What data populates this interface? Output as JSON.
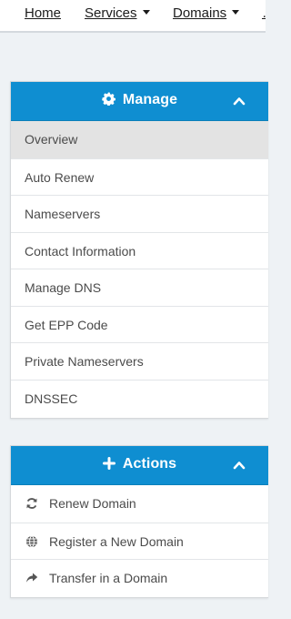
{
  "topnav": {
    "items": [
      {
        "label": "Home",
        "dropdown": false
      },
      {
        "label": "Services",
        "dropdown": true
      },
      {
        "label": "Domains",
        "dropdown": true
      }
    ]
  },
  "manage": {
    "title": "Manage",
    "icon": "gear-icon",
    "collapse_icon": "chevron-up-icon",
    "items": [
      {
        "label": "Overview",
        "active": true
      },
      {
        "label": "Auto Renew"
      },
      {
        "label": "Nameservers"
      },
      {
        "label": "Contact Information"
      },
      {
        "label": "Manage DNS"
      },
      {
        "label": "Get EPP Code"
      },
      {
        "label": "Private Nameservers"
      },
      {
        "label": "DNSSEC"
      }
    ]
  },
  "actions": {
    "title": "Actions",
    "icon": "plus-icon",
    "collapse_icon": "chevron-up-icon",
    "items": [
      {
        "label": "Renew Domain",
        "icon": "refresh-icon"
      },
      {
        "label": "Register a New Domain",
        "icon": "globe-icon"
      },
      {
        "label": "Transfer in a Domain",
        "icon": "share-arrow-icon"
      }
    ]
  },
  "colors": {
    "header_blue": "#0f8ed1",
    "active_item_bg": "#e3e3e3",
    "page_bg": "#eef2f5"
  }
}
